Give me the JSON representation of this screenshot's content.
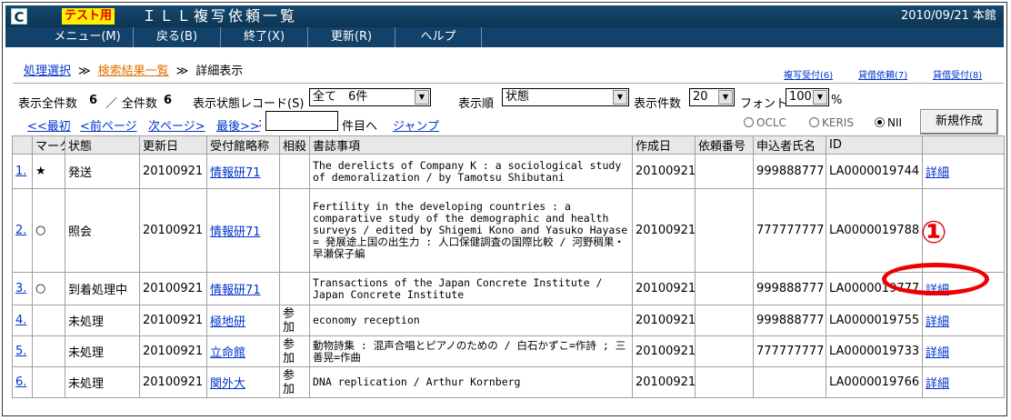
{
  "header": {
    "logo": "C",
    "test_badge": "テスト用",
    "title": "ＩＬＬ複写依頼一覧",
    "date_info": "2010/09/21 本館"
  },
  "menu": [
    "メニュー(M)",
    "戻る(B)",
    "終了(X)",
    "更新(R)",
    "ヘルプ"
  ],
  "breadcrumb": {
    "step1": "処理選択",
    "sep": "≫",
    "step2": "検索結果一覧",
    "step3": "詳細表示"
  },
  "top_links": [
    "複写受付(6)",
    "貸借依頼(7)",
    "貸借受付(8)"
  ],
  "filters": {
    "total_label": "表示全件数",
    "total_value": "6",
    "slash": "／",
    "all_label": "全件数",
    "all_value": "6",
    "status_label": "表示状態レコード(S)",
    "status_value": "全て　6件",
    "order_label": "表示順",
    "order_value": "状態",
    "count_label": "表示件数",
    "count_value": "20",
    "font_label": "フォント",
    "font_value": "100",
    "percent": "%"
  },
  "paging": {
    "first": "<<最初",
    "prev": "<前ページ",
    "next": "次ページ>",
    "last": "最後>>",
    "colon": ":",
    "goto_label": "件目へ",
    "jump": "ジャンプ"
  },
  "sources": {
    "options": [
      "OCLC",
      "KERIS",
      "NII"
    ],
    "selected": "NII"
  },
  "new_button": "新規作成",
  "table": {
    "columns": [
      "",
      "マーク",
      "状態",
      "更新日",
      "受付館略称",
      "相殺",
      "書誌事項",
      "作成日",
      "依頼番号",
      "申込者氏名",
      "ID",
      ""
    ],
    "rows": [
      {
        "no": "1.",
        "mark": "★",
        "status": "発送",
        "updated": "20100921",
        "library": "情報研71",
        "offset": "",
        "title": "The derelicts of Company K : a sociological study of demoralization / by Tamotsu Shibutani",
        "created": "20100921",
        "req_no": "",
        "applicant": "999888777",
        "id": "LA0000019744",
        "detail": "詳細"
      },
      {
        "no": "2.",
        "mark": "○",
        "status": "照会",
        "updated": "20100921",
        "library": "情報研71",
        "offset": "",
        "title": "Fertility in the developing countries : a comparative study of the demographic and health surveys / edited by Shigemi Kono and Yasuko Hayase = 発展途上国の出生力 : 人口保健調査の国際比較 / 河野稠果・早瀬保子編",
        "created": "20100921",
        "req_no": "",
        "applicant": "777777777",
        "id": "LA0000019788",
        "detail": ""
      },
      {
        "no": "3.",
        "mark": "○",
        "status": "到着処理中",
        "updated": "20100921",
        "library": "情報研71",
        "offset": "",
        "title": "Transactions of the Japan Concrete Institute / Japan Concrete Institute",
        "created": "20100921",
        "req_no": "",
        "applicant": "999888777",
        "id": "LA0000019777",
        "detail": "詳細"
      },
      {
        "no": "4.",
        "mark": "",
        "status": "未処理",
        "updated": "20100921",
        "library": "極地研",
        "offset": "参加",
        "title": "economy reception",
        "created": "20100921",
        "req_no": "",
        "applicant": "999888777",
        "id": "LA0000019755",
        "detail": "詳細"
      },
      {
        "no": "5.",
        "mark": "",
        "status": "未処理",
        "updated": "20100921",
        "library": "立命館",
        "offset": "参加",
        "title": "動物詩集 : 混声合唱とピアノのための / 白石かずこ=作詩 ; 三善晃=作曲",
        "created": "20100921",
        "req_no": "",
        "applicant": "777777777",
        "id": "LA0000019733",
        "detail": "詳細"
      },
      {
        "no": "6.",
        "mark": "",
        "status": "未処理",
        "updated": "20100921",
        "library": "関外大",
        "offset": "参加",
        "title": "DNA replication / Arthur Kornberg",
        "created": "20100921",
        "req_no": "",
        "applicant": "",
        "id": "LA0000019766",
        "detail": "詳細"
      }
    ]
  },
  "annotation": {
    "marker": "①",
    "color": "#ee0000"
  }
}
